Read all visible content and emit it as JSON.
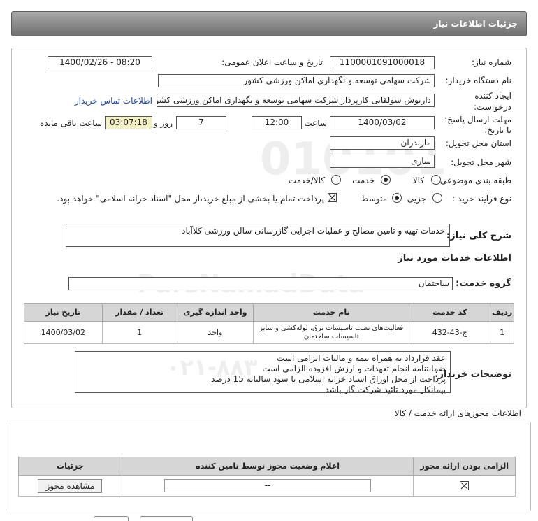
{
  "header": {
    "title": "جزئیات اطلاعات نیاز"
  },
  "form": {
    "need_number_label": "شماره نیاز:",
    "need_number": "1100001091000018",
    "announce_label": "تاریخ و ساعت اعلان عمومی:",
    "announce_value": "1400/02/26 - 08:20",
    "buyer_org_label": "نام دستگاه خریدار:",
    "buyer_org": "شرکت سهامی توسعه و نگهداری اماکن ورزشی کشور",
    "creator_label_1": "ایجاد کننده",
    "creator_label_2": "درخواست:",
    "creator": "داریوش سولقانی کارپرداز شرکت سهامی توسعه و نگهداری اماکن ورزشی کشو",
    "contact_link": "اطلاعات تماس خریدار",
    "deadline_label_1": "مهلت ارسال پاسخ:",
    "deadline_label_2": "تا تاریخ:",
    "deadline_date": "1400/03/02",
    "time_label": "ساعت",
    "deadline_time": "12:00",
    "days_value": "7",
    "days_label": "روز و",
    "remaining_time": "03:07:18",
    "remaining_label": "ساعت باقی مانده",
    "province_label": "استان محل تحویل:",
    "province": "مازندران",
    "city_label": "شهر محل تحویل:",
    "city": "ساری",
    "category_label": "طبقه بندی موضوعی:",
    "category_options": [
      "کالا",
      "خدمت",
      "کالا/خدمت"
    ],
    "category_selected": "خدمت",
    "process_label": "نوع فرآیند خرید :",
    "process_options": [
      "جزیی",
      "متوسط"
    ],
    "process_selected": "متوسط",
    "payment_note": "پرداخت تمام یا بخشی از مبلغ خرید،از محل \"اسناد خزانه اسلامی\" خواهد بود."
  },
  "description": {
    "label": "شرح کلی نیاز:",
    "value": "خدمات تهیه و تامین مصالح و عملیات اجرایی گازرسانی سالن ورزشی کلاآباد"
  },
  "services": {
    "section_title": "اطلاعات خدمات مورد نیاز",
    "group_label": "گروه خدمت:",
    "group_value": "ساختمان",
    "columns": [
      "ردیف",
      "کد خدمت",
      "نام خدمت",
      "واحد اندازه گیری",
      "تعداد / مقدار",
      "تاریخ نیاز"
    ],
    "rows": [
      {
        "row": "1",
        "code": "ج-43-432",
        "name_line1": "فعالیت‌های نصب تاسیسات برق، لوله‌کشی و سایر",
        "name_line2": "تاسیسات ساختمان",
        "unit": "واحد",
        "qty": "1",
        "date": "1400/03/02"
      }
    ]
  },
  "buyer_notes": {
    "label": "توضیحات خریدار:",
    "lines": [
      "عقد قرارداد به همراه بیمه و مالیات الزامی است",
      "ضمانتنامه انجام تعهدات و ارزش افزوده الزامی است",
      "پرداخت از محل اوراق اسناد خزانه اسلامی با سود سالیانه 15 درصد",
      "پیمانکار مورد تائید شرکت گاز باشد"
    ]
  },
  "permits": {
    "title": "اطلاعات مجوزهای ارائه خدمت / کالا",
    "columns": [
      "الزامی بودن ارائه مجوز",
      "اعلام وضعیت مجوز توسط تامین کننده",
      "جزئیات"
    ],
    "row": {
      "status": "--",
      "view_button": "مشاهده مجوز"
    }
  },
  "watermark": {
    "line1": "ParsNamadData",
    "line2": "۰۲۱-۸۸۳",
    "line3": "010101"
  }
}
